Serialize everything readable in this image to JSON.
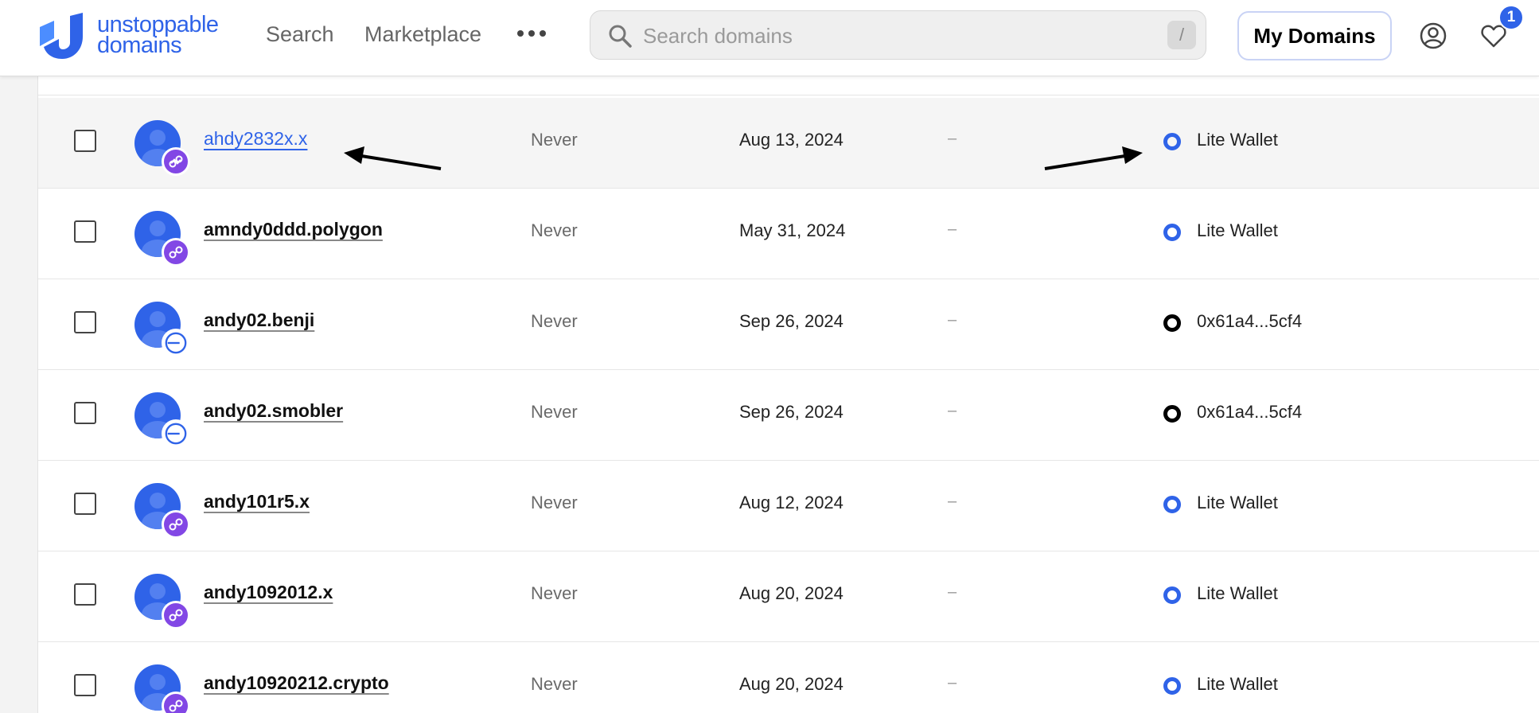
{
  "header": {
    "logo_line1": "unstoppable",
    "logo_line2": "domains",
    "nav_search": "Search",
    "nav_marketplace": "Marketplace",
    "search_placeholder": "Search domains",
    "search_shortcut": "/",
    "my_domains_label": "My Domains",
    "favorites_count": "1"
  },
  "colors": {
    "brand": "#2f63e8",
    "polygon": "#8247e5"
  },
  "rows": [
    {
      "domain": "ahdy2832x.x",
      "expiry": "Never",
      "purchased": "Aug 13, 2024",
      "dash": "–",
      "wallet": "Lite Wallet",
      "chain": "polygon-icon",
      "wallet_type": "lite"
    },
    {
      "domain": "amndy0ddd.polygon",
      "expiry": "Never",
      "purchased": "May 31, 2024",
      "dash": "–",
      "wallet": "Lite Wallet",
      "chain": "polygon-icon",
      "wallet_type": "lite"
    },
    {
      "domain": "andy02.benji",
      "expiry": "Never",
      "purchased": "Sep 26, 2024",
      "dash": "–",
      "wallet": "0x61a4...5cf4",
      "chain": "base-icon",
      "wallet_type": "external"
    },
    {
      "domain": "andy02.smobler",
      "expiry": "Never",
      "purchased": "Sep 26, 2024",
      "dash": "–",
      "wallet": "0x61a4...5cf4",
      "chain": "base-icon",
      "wallet_type": "external"
    },
    {
      "domain": "andy101r5.x",
      "expiry": "Never",
      "purchased": "Aug 12, 2024",
      "dash": "–",
      "wallet": "Lite Wallet",
      "chain": "polygon-icon",
      "wallet_type": "lite"
    },
    {
      "domain": "andy1092012.x",
      "expiry": "Never",
      "purchased": "Aug 20, 2024",
      "dash": "–",
      "wallet": "Lite Wallet",
      "chain": "polygon-icon",
      "wallet_type": "lite"
    },
    {
      "domain": "andy10920212.crypto",
      "expiry": "Never",
      "purchased": "Aug 20, 2024",
      "dash": "–",
      "wallet": "Lite Wallet",
      "chain": "polygon-icon",
      "wallet_type": "lite"
    }
  ]
}
